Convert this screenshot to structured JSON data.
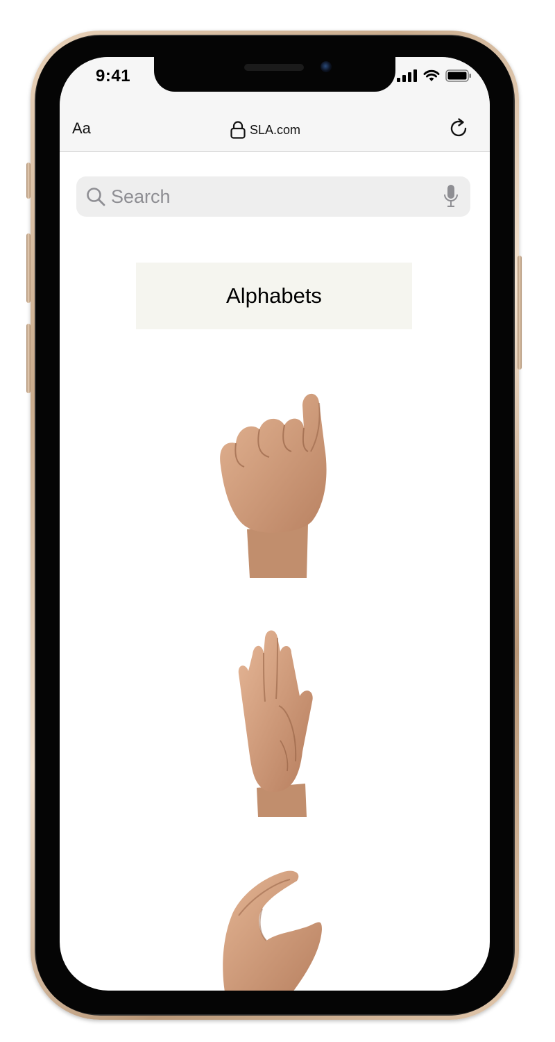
{
  "status_bar": {
    "time": "9:41",
    "icons": [
      "cellular-signal-icon",
      "wifi-icon",
      "battery-icon"
    ]
  },
  "browser": {
    "text_size_label": "Aa",
    "url": "SLA.com",
    "lock_icon": "lock-icon",
    "reload_icon": "reload-icon"
  },
  "search": {
    "placeholder": "Search",
    "icon": "search-icon",
    "mic_icon": "microphone-icon"
  },
  "page": {
    "title": "Alphabets",
    "signs": [
      {
        "id": "sign-a",
        "icon": "fist-hand-image"
      },
      {
        "id": "sign-b",
        "icon": "flat-hand-image"
      },
      {
        "id": "sign-c",
        "icon": "curved-hand-image"
      }
    ]
  },
  "colors": {
    "title_background": "#f5f5ef",
    "search_background": "#eeeeee",
    "browser_bar": "#f6f6f6",
    "skin": "#d4a07a",
    "frame_gold": "#d9bfa2"
  }
}
